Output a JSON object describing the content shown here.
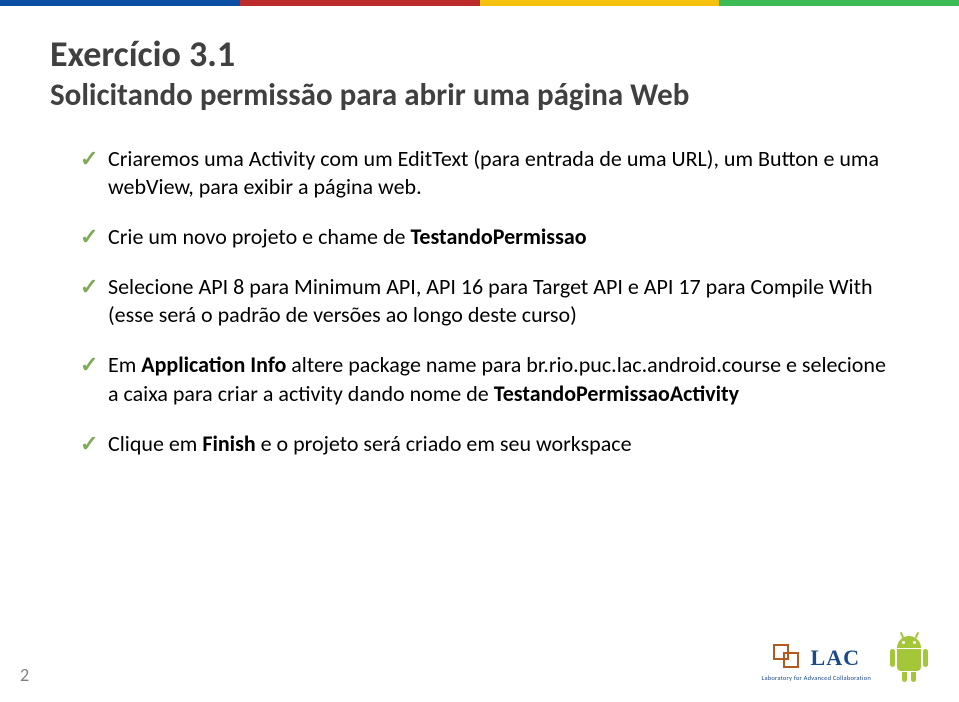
{
  "slide": {
    "title": "Exercício 3.1",
    "subtitle": "Solicitando permissão para abrir uma página Web",
    "bullets": [
      {
        "prefix": "Criaremos uma Activity com um EditText (para entrada de uma URL), um Button e uma webView, para exibir a página web."
      },
      {
        "prefix": "Crie um novo projeto e chame de ",
        "bold1": "TestandoPermissao"
      },
      {
        "prefix": "Selecione API 8 para Minimum API, API 16 para Target API e API 17 para Compile With (esse será o padrão de versões ao longo deste curso)"
      },
      {
        "prefix": "Em ",
        "bold1": "Application Info",
        "mid": " altere package name para br.rio.puc.lac.android.course e selecione a caixa para criar a activity dando nome de ",
        "bold2": "TestandoPermissaoActivity"
      },
      {
        "prefix": "Clique em ",
        "bold1": "Finish",
        "mid": " e o projeto será criado em seu workspace"
      }
    ],
    "page_number": "2"
  },
  "colors": {
    "stripe": [
      "#0b4ea2",
      "#bd2c2c",
      "#f4c20d",
      "#3cba54"
    ]
  },
  "logos": {
    "lac": {
      "text": "LAC",
      "sub": "Laboratory for Advanced Collaboration"
    },
    "android": "android-icon"
  }
}
